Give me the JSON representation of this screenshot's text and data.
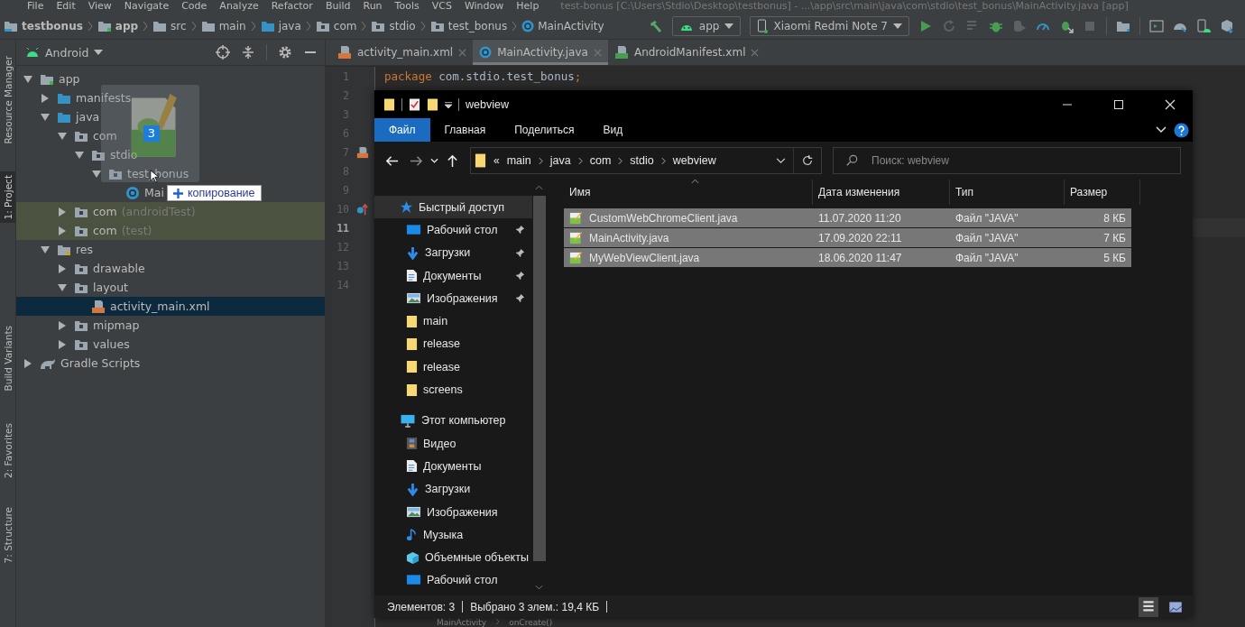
{
  "menu_bar": {
    "items": [
      "File",
      "Edit",
      "View",
      "Navigate",
      "Code",
      "Analyze",
      "Refactor",
      "Build",
      "Run",
      "Tools",
      "VCS",
      "Window",
      "Help"
    ],
    "title": "test-bonus [C:\\Users\\Stdio\\Desktop\\testbonus] - ...\\app\\src\\main\\java\\com\\stdio\\test_bonus\\MainActivity.java [app]"
  },
  "breadcrumbs": [
    {
      "label": "testbonus",
      "kind": "project"
    },
    {
      "label": "app",
      "kind": "module"
    },
    {
      "label": "src",
      "kind": "folder"
    },
    {
      "label": "main",
      "kind": "folder"
    },
    {
      "label": "java",
      "kind": "source"
    },
    {
      "label": "com",
      "kind": "package"
    },
    {
      "label": "stdio",
      "kind": "package"
    },
    {
      "label": "test_bonus",
      "kind": "package"
    },
    {
      "label": "MainActivity",
      "kind": "class"
    }
  ],
  "run_config": {
    "module": "app",
    "device": "Xiaomi Redmi Note 7"
  },
  "side_tools": [
    {
      "label": "Resource Manager",
      "selected": false
    },
    {
      "label": "1: Project",
      "selected": true
    },
    {
      "label": "Build Variants",
      "selected": false
    },
    {
      "label": "2: Favorites",
      "selected": false
    },
    {
      "label": "7: Structure",
      "selected": false
    }
  ],
  "project_panel": {
    "view": "Android",
    "tree": [
      {
        "label": "app",
        "kind": "module",
        "expanded": true,
        "selected": false,
        "highlighted": false,
        "children": [
          {
            "label": "manifests",
            "kind": "source",
            "expanded": false,
            "selected": false,
            "highlighted": false
          },
          {
            "label": "java",
            "kind": "source",
            "expanded": true,
            "selected": false,
            "highlighted": false,
            "children": [
              {
                "label": "com",
                "kind": "package",
                "expanded": true,
                "selected": false,
                "highlighted": false,
                "children": [
                  {
                    "label": "stdio",
                    "kind": "package",
                    "expanded": true,
                    "selected": false,
                    "highlighted": false,
                    "children": [
                      {
                        "label": "test_bonus",
                        "kind": "package",
                        "expanded": true,
                        "selected": false,
                        "highlighted": false,
                        "children": [
                          {
                            "label": "Mai",
                            "kind": "class",
                            "selected": false,
                            "highlighted": false
                          }
                        ]
                      }
                    ]
                  }
                ]
              },
              {
                "label": "com",
                "suffix": "(androidTest)",
                "kind": "package",
                "expanded": false,
                "selected": false,
                "highlighted": true
              },
              {
                "label": "com",
                "suffix": "(test)",
                "kind": "package",
                "expanded": false,
                "selected": false,
                "highlighted": true
              }
            ]
          },
          {
            "label": "res",
            "kind": "res",
            "expanded": true,
            "selected": false,
            "highlighted": false,
            "children": [
              {
                "label": "drawable",
                "kind": "package",
                "expanded": false,
                "selected": false,
                "highlighted": false
              },
              {
                "label": "layout",
                "kind": "package",
                "expanded": true,
                "selected": false,
                "highlighted": false,
                "children": [
                  {
                    "label": "activity_main.xml",
                    "kind": "xml",
                    "selected": true,
                    "highlighted": false
                  }
                ]
              },
              {
                "label": "mipmap",
                "kind": "package",
                "expanded": false,
                "selected": false,
                "highlighted": false
              },
              {
                "label": "values",
                "kind": "package",
                "expanded": false,
                "selected": false,
                "highlighted": false
              }
            ]
          }
        ]
      },
      {
        "label": "Gradle Scripts",
        "kind": "gradle",
        "expanded": false,
        "selected": false,
        "highlighted": false
      }
    ]
  },
  "drag": {
    "count": "3",
    "action": "копирование"
  },
  "editor": {
    "tabs": [
      {
        "label": "activity_main.xml",
        "kind": "xml",
        "selected": false
      },
      {
        "label": "MainActivity.java",
        "kind": "class",
        "selected": true
      },
      {
        "label": "AndroidManifest.xml",
        "kind": "manifest",
        "selected": false
      }
    ],
    "lines": [
      {
        "number": "1",
        "current": false,
        "kind": "plain",
        "tokens": [
          {
            "text": "package",
            "kind": "keyword"
          },
          {
            "text": " com.stdio.test_bonus",
            "kind": "plain"
          },
          {
            "text": ";",
            "kind": "keyword"
          }
        ]
      },
      {
        "number": "2",
        "current": false,
        "kind": "plain"
      },
      {
        "number": "3",
        "current": false,
        "kind": "plain"
      },
      {
        "number": "6",
        "current": false,
        "kind": "plain"
      },
      {
        "number": "7",
        "current": false,
        "kind": "xml"
      },
      {
        "number": "8",
        "current": false,
        "kind": "plain"
      },
      {
        "number": "9",
        "current": false,
        "kind": "plain"
      },
      {
        "number": "10",
        "current": false,
        "kind": "override"
      },
      {
        "number": "11",
        "current": true,
        "kind": "plain"
      },
      {
        "number": "12",
        "current": false,
        "kind": "plain"
      },
      {
        "number": "13",
        "current": false,
        "kind": "plain"
      },
      {
        "number": "14",
        "current": false,
        "kind": "plain"
      }
    ],
    "footer": [
      "MainActivity",
      "onCreate()"
    ]
  },
  "explorer": {
    "title": "webview",
    "ribbon_tabs": [
      {
        "label": "Файл",
        "selected": true
      },
      {
        "label": "Главная",
        "selected": false
      },
      {
        "label": "Поделиться",
        "selected": false
      },
      {
        "label": "Вид",
        "selected": false
      }
    ],
    "path_overflow": "«",
    "path": [
      "main",
      "java",
      "com",
      "stdio",
      "webview"
    ],
    "search": {
      "placeholder": "Поиск: webview"
    },
    "nav": [
      {
        "label": "Быстрый доступ",
        "kind": "star",
        "selected": true,
        "children": [
          {
            "label": "Рабочий стол",
            "kind": "desktop",
            "pinned": true,
            "selected": false
          },
          {
            "label": "Загрузки",
            "kind": "download",
            "pinned": true,
            "selected": false
          },
          {
            "label": "Документы",
            "kind": "docs",
            "pinned": true,
            "selected": false
          },
          {
            "label": "Изображения",
            "kind": "images",
            "pinned": true,
            "selected": false
          },
          {
            "label": "main",
            "kind": "folder",
            "pinned": false,
            "selected": false
          },
          {
            "label": "release",
            "kind": "folder",
            "pinned": false,
            "selected": false
          },
          {
            "label": "release",
            "kind": "folder",
            "pinned": false,
            "selected": false
          },
          {
            "label": "screens",
            "kind": "folder",
            "pinned": false,
            "selected": false
          }
        ]
      },
      {
        "label": "Этот компьютер",
        "kind": "pc",
        "selected": false,
        "children": [
          {
            "label": "Видео",
            "kind": "video",
            "selected": false
          },
          {
            "label": "Документы",
            "kind": "docs",
            "selected": false
          },
          {
            "label": "Загрузки",
            "kind": "download",
            "selected": false
          },
          {
            "label": "Изображения",
            "kind": "images",
            "selected": false
          },
          {
            "label": "Музыка",
            "kind": "music",
            "selected": false
          },
          {
            "label": "Объемные объекты",
            "kind": "objects",
            "selected": false
          },
          {
            "label": "Рабочий стол",
            "kind": "desktop",
            "selected": false
          }
        ]
      }
    ],
    "columns": [
      "Имя",
      "Дата изменения",
      "Тип",
      "Размер"
    ],
    "files": [
      {
        "name": "CustomWebChromeClient.java",
        "modified": "11.07.2020 11:20",
        "type": "Файл \"JAVA\"",
        "size": "8 КБ",
        "selected": true
      },
      {
        "name": "MainActivity.java",
        "modified": "17.09.2020 22:11",
        "type": "Файл \"JAVA\"",
        "size": "7 КБ",
        "selected": true
      },
      {
        "name": "MyWebViewClient.java",
        "modified": "18.06.2020 11:47",
        "type": "Файл \"JAVA\"",
        "size": "5 КБ",
        "selected": true
      }
    ],
    "status": {
      "count": "Элементов: 3",
      "selection": "Выбрано 3 элем.: 19,4 КБ"
    }
  }
}
